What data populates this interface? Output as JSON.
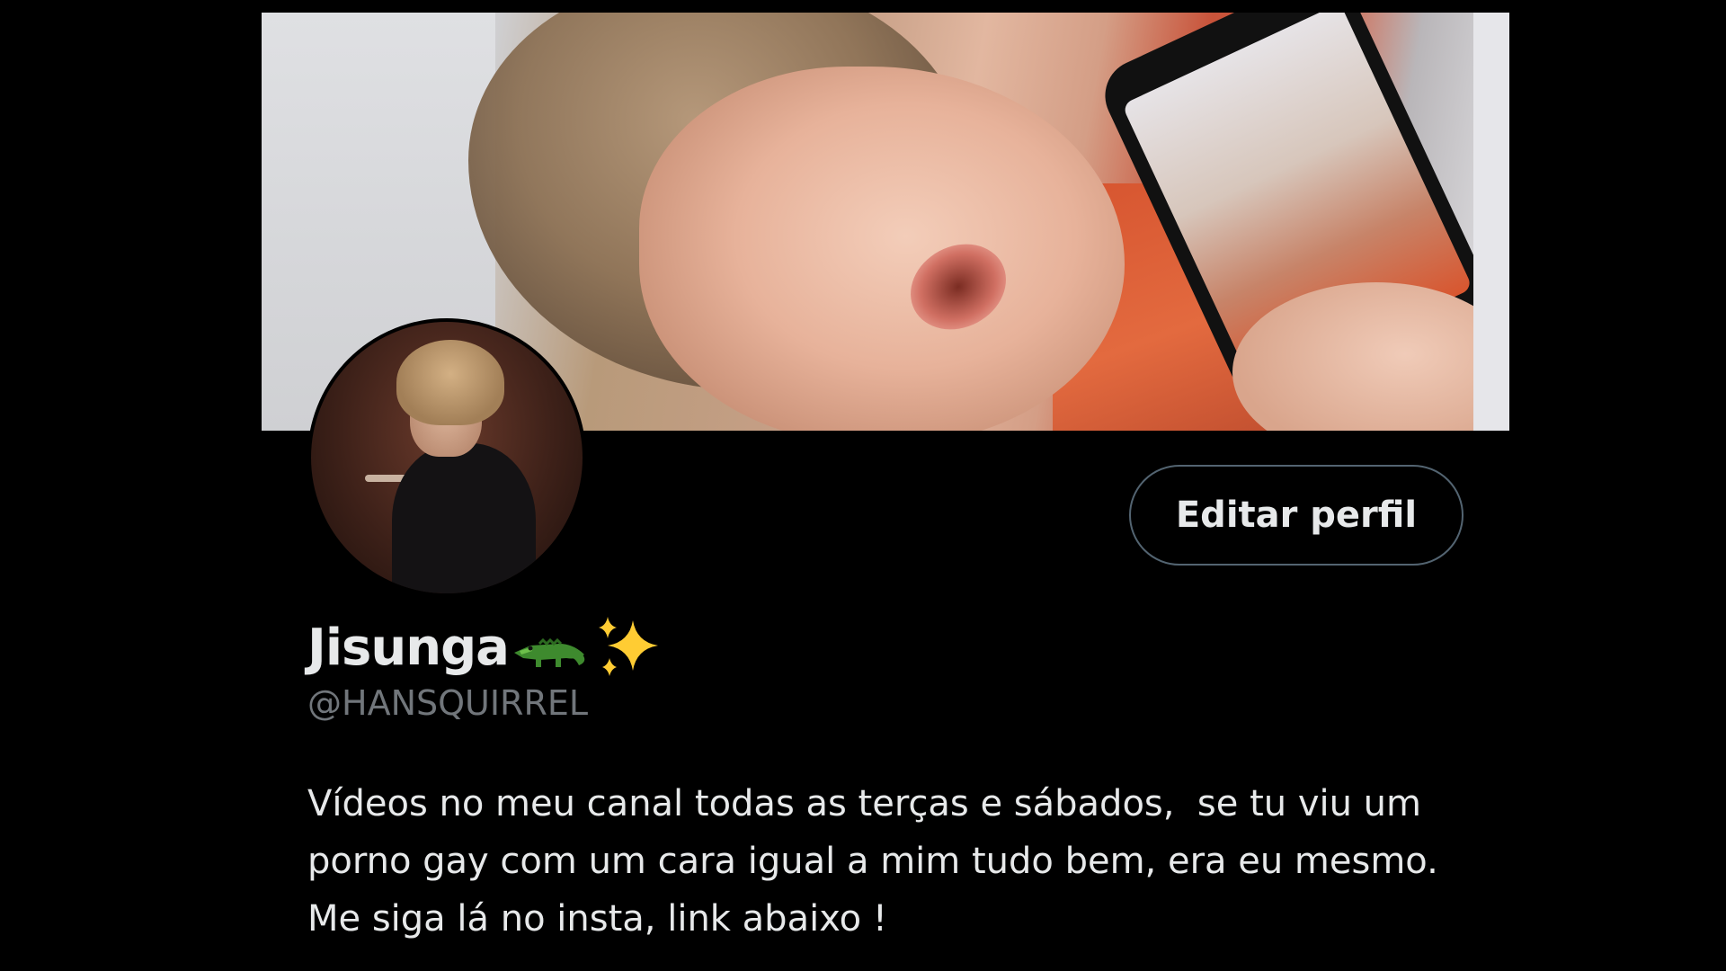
{
  "profile": {
    "display_name": "Jisunga",
    "name_emojis": [
      "crocodile-icon",
      "sparkles-icon"
    ],
    "handle": "@HANSQUIRREL",
    "bio": "Vídeos no meu canal todas as terças e sábados,  se tu viu um porno gay com um cara igual a mim tudo bem, era eu mesmo. Me siga lá no insta, link abaixo !"
  },
  "actions": {
    "edit_profile_label": "Editar perfil"
  },
  "colors": {
    "background": "#000000",
    "primary_text": "#e7e9ea",
    "secondary_text": "#71767b",
    "button_border": "#536471"
  }
}
